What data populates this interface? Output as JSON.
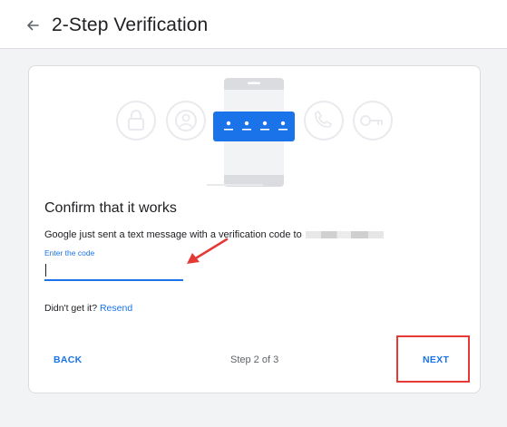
{
  "header": {
    "title": "2-Step Verification",
    "back_icon": "arrow-left-icon"
  },
  "card": {
    "illustration_code": "• • • •",
    "illustration_icons": [
      "lock-icon",
      "account-icon",
      "phone-call-icon",
      "key-icon"
    ],
    "confirm_title": "Confirm that it works",
    "message": "Google just sent a text message with a verification code to",
    "input": {
      "label": "Enter the code",
      "value": "",
      "placeholder": ""
    },
    "didnt_get": "Didn't get it?",
    "resend_label": "Resend",
    "footer": {
      "back_label": "BACK",
      "step_text": "Step 2 of 3",
      "next_label": "NEXT"
    }
  },
  "colors": {
    "accent": "#1a73e8",
    "annotation_red": "#e53935",
    "page_background": "#f1f3f4"
  }
}
